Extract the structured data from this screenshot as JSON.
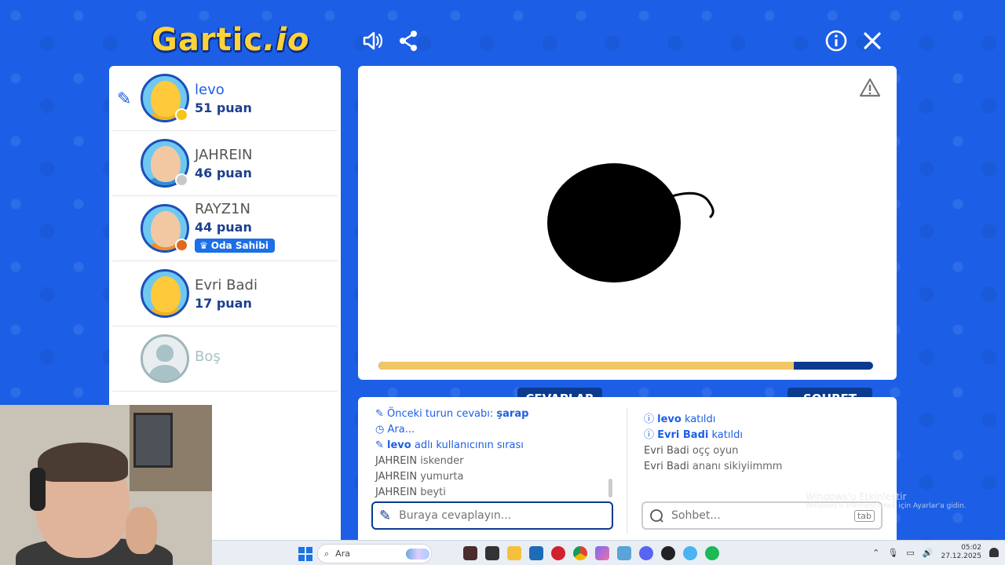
{
  "app": {
    "logo_text": "Gartic",
    "logo_suffix": ".io"
  },
  "top_icons": [
    "sound-icon",
    "share-icon",
    "info-icon",
    "close-icon"
  ],
  "players": [
    {
      "name": "levo",
      "points": "51 puan",
      "status_color": "#f5c518",
      "is_me": true,
      "drawing": true
    },
    {
      "name": "JAHREIN",
      "points": "46 puan",
      "status_color": "#c8c8c8",
      "is_me": false
    },
    {
      "name": "RAYZ1N",
      "points": "44 puan",
      "status_color": "#e06a1b",
      "is_me": false,
      "badge": "Oda Sahibi"
    },
    {
      "name": "Evri Badi",
      "points": "17 puan",
      "status_color": null,
      "is_me": false
    }
  ],
  "empty_slot": {
    "label": "Boş"
  },
  "canvas": {
    "progress": 0.84,
    "colors": {
      "progress_fill": "#f0c765",
      "progress_track": "#0b3b8f"
    }
  },
  "tabs": {
    "answers_label": "CEVAPLAR",
    "chat_label": "SOHBET"
  },
  "answers": {
    "messages": [
      {
        "type": "sys",
        "icon": "pencil-icon",
        "text": "Önceki turun cevabı:",
        "strong": "şarap"
      },
      {
        "type": "sys",
        "icon": "clock-icon",
        "text": "Ara...",
        "strong": ""
      },
      {
        "type": "sys",
        "icon": "pencil-icon",
        "strong": "levo",
        "text": "adlı kullanıcının sırası"
      },
      {
        "type": "user",
        "user": "JAHREIN",
        "text": "iskender"
      },
      {
        "type": "user",
        "user": "JAHREIN",
        "text": "yumurta"
      },
      {
        "type": "user",
        "user": "JAHREIN",
        "text": "beyti"
      }
    ],
    "input_placeholder": "Buraya cevaplayın..."
  },
  "chat": {
    "messages": [
      {
        "type": "sys",
        "icon": "info-icon",
        "strong": "levo",
        "text": "katıldı"
      },
      {
        "type": "sys",
        "icon": "info-icon",
        "strong": "Evri Badi",
        "text": "katıldı"
      },
      {
        "type": "user",
        "user": "Evri Badi",
        "text": "oçç oyun"
      },
      {
        "type": "user",
        "user": "Evri Badi",
        "text": "ananı sikiyiimmm"
      }
    ],
    "input_placeholder": "Sohbet...",
    "tab_key": "tab"
  },
  "watermark": {
    "line1": "Windows'u Etkinleştir",
    "line2": "Windows'u etkinleştirmek için Ayarlar'a gidin."
  },
  "taskbar": {
    "search_label": "Ara",
    "time": "05:02",
    "date": "27.12.2025"
  }
}
